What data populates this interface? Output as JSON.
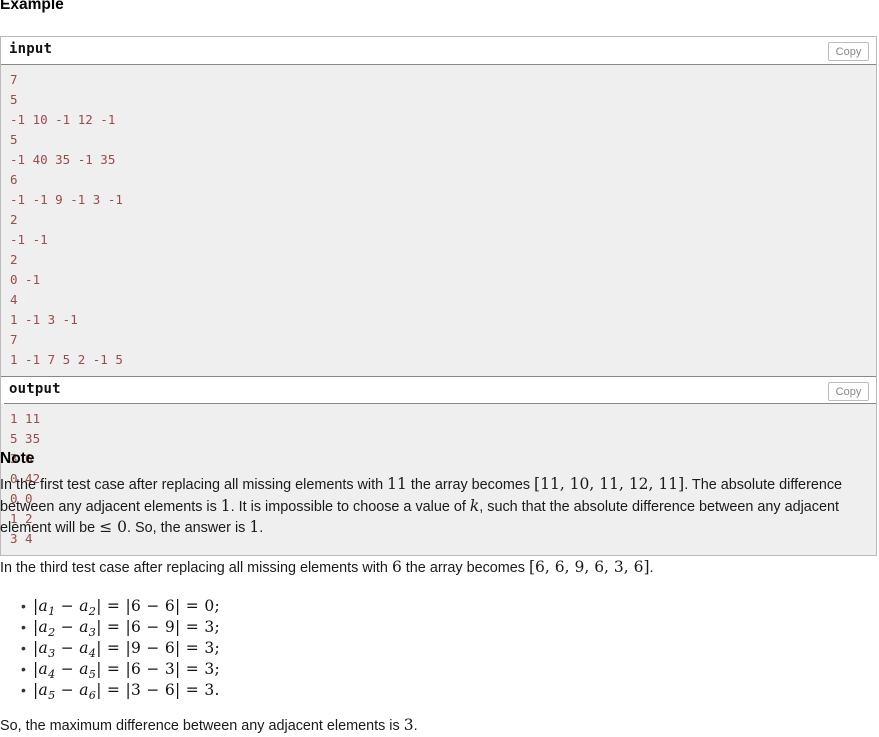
{
  "headings": {
    "example": "Example",
    "note": "Note"
  },
  "sample_tests": [
    {
      "title": "input",
      "copy_label": "Copy",
      "content": "7\n5\n-1 10 -1 12 -1\n5\n-1 40 35 -1 35\n6\n-1 -1 9 -1 3 -1\n2\n-1 -1\n2\n0 -1\n4\n1 -1 3 -1\n7\n1 -1 7 5 2 -1 5"
    },
    {
      "title": "output",
      "copy_label": "Copy",
      "content": "1 11\n5 35\n3 6\n0 42\n0 0\n1 2\n3 4"
    }
  ],
  "note": {
    "paragraph1": {
      "t1": "In the first test case after replacing all missing elements with ",
      "m1": "11",
      "t2": " the array becomes ",
      "m2": "[11, 10, 11, 12, 11]",
      "t3": ". The absolute difference between any adjacent elements is ",
      "m3": "1",
      "t4": ". It is impossible to choose a value of ",
      "m4": "k",
      "t5": ", such that the absolute difference between any adjacent element will be ",
      "m5": "≤ 0",
      "t6": ". So, the answer is ",
      "m6": "1",
      "t7": "."
    },
    "paragraph2": {
      "t1": "In the third test case after replacing all missing elements with ",
      "m1": "6",
      "t2": " the array becomes ",
      "m2": "[6, 6, 9, 6, 3, 6]",
      "t3": "."
    },
    "bullets": [
      {
        "bullet": "•",
        "lhs_a": "a",
        "lhs_a_sub": "1",
        "lhs_b": "a",
        "lhs_b_sub": "2",
        "mid": "|6 − 6|",
        "result": "0",
        "punct": ";"
      },
      {
        "bullet": "•",
        "lhs_a": "a",
        "lhs_a_sub": "2",
        "lhs_b": "a",
        "lhs_b_sub": "3",
        "mid": "|6 − 9|",
        "result": "3",
        "punct": ";"
      },
      {
        "bullet": "•",
        "lhs_a": "a",
        "lhs_a_sub": "3",
        "lhs_b": "a",
        "lhs_b_sub": "4",
        "mid": "|9 − 6|",
        "result": "3",
        "punct": ";"
      },
      {
        "bullet": "•",
        "lhs_a": "a",
        "lhs_a_sub": "4",
        "lhs_b": "a",
        "lhs_b_sub": "5",
        "mid": "|6 − 3|",
        "result": "3",
        "punct": ";"
      },
      {
        "bullet": "•",
        "lhs_a": "a",
        "lhs_a_sub": "5",
        "lhs_b": "a",
        "lhs_b_sub": "6",
        "mid": "|3 − 6|",
        "result": "3",
        "punct": "."
      }
    ],
    "conclusion": {
      "t1": "So, the maximum difference between any adjacent elements is ",
      "m1": "3",
      "t2": "."
    }
  },
  "colors": {
    "code_text": "#9c4a4a",
    "code_bg": "#efefef",
    "border": "#bbbbbb",
    "copy_text": "#888888"
  }
}
